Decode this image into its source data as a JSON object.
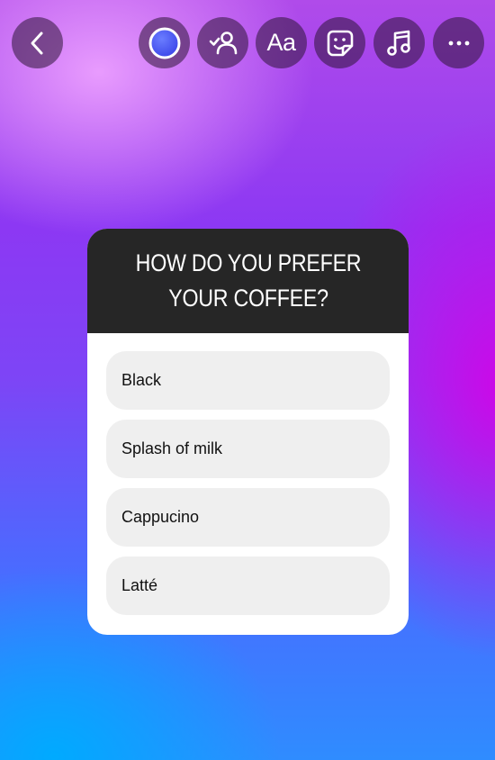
{
  "toolbar": {
    "buttons": [
      {
        "name": "back",
        "icon": "chevron-left-icon"
      },
      {
        "name": "color",
        "icon": "color-circle-icon",
        "color": "#4a5cff"
      },
      {
        "name": "mention",
        "icon": "mention-person-icon"
      },
      {
        "name": "text",
        "icon": "text-icon",
        "label": "Aa"
      },
      {
        "name": "sticker",
        "icon": "sticker-icon"
      },
      {
        "name": "music",
        "icon": "music-note-icon"
      },
      {
        "name": "more",
        "icon": "more-icon"
      }
    ]
  },
  "quiz": {
    "question": "HOW DO YOU PREFER YOUR COFFEE?",
    "options": [
      "Black",
      "Splash of milk",
      "Cappucino",
      "Latté"
    ]
  }
}
